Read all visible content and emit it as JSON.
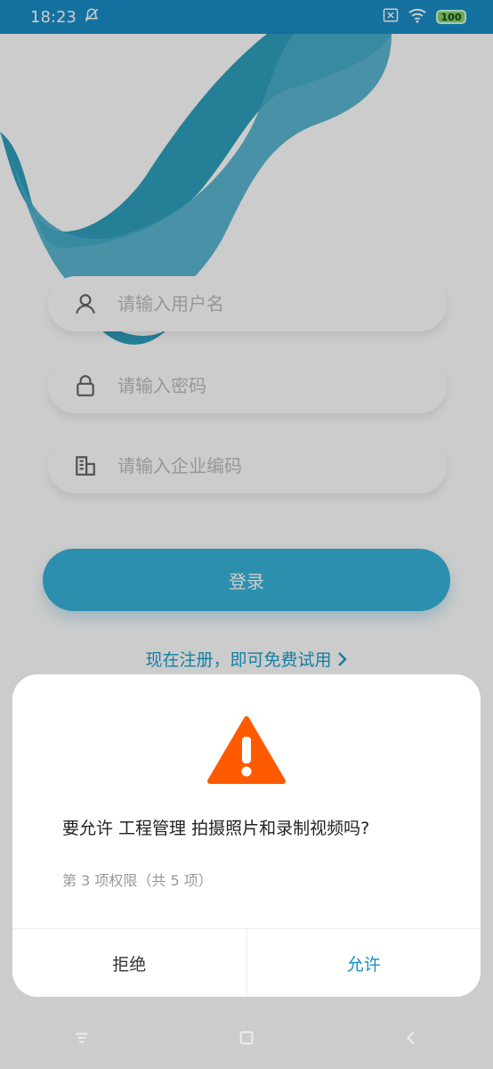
{
  "status_bar": {
    "time": "18:23",
    "icons": [
      "notification-off-icon",
      "close-box-icon",
      "wifi-icon"
    ],
    "battery": "100"
  },
  "form": {
    "username_placeholder": "请输入用户名",
    "password_placeholder": "请输入密码",
    "company_placeholder": "请输入企业编码"
  },
  "login_button": "登录",
  "register_link": "现在注册，即可免费试用",
  "dialog": {
    "message": "要允许 工程管理 拍摄照片和录制视频吗?",
    "sub": "第 3 项权限（共 5 项）",
    "deny": "拒绝",
    "allow": "允许"
  },
  "colors": {
    "accent": "#1a8ec7",
    "button": "#38b3d9",
    "warning": "#ff5a00"
  }
}
